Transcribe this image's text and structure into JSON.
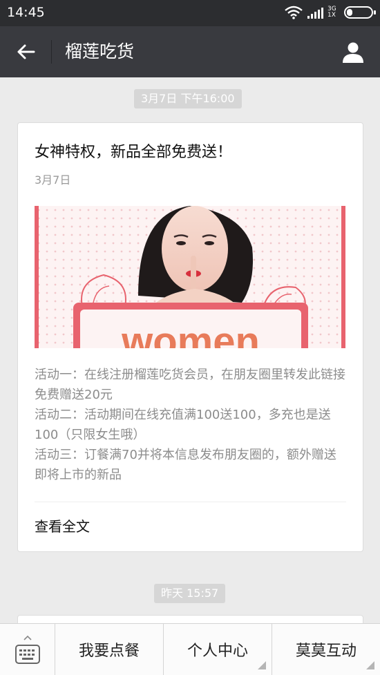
{
  "status_bar": {
    "time": "14:45",
    "network_top": "3G",
    "network_bottom": "1X"
  },
  "nav": {
    "title": "榴莲吃货",
    "back_icon": "arrow-left-icon",
    "profile_icon": "person-icon"
  },
  "timestamps": {
    "first": "3月7日 下午16:00",
    "second": "昨天 15:57"
  },
  "article": {
    "title": "女神特权，新品全部免费送！",
    "date": "3月7日",
    "image_text": "women",
    "description": [
      "活动一：在线注册榴莲吃货会员，在朋友圈里转发此链接免费赠送20元",
      "活动二：活动期间在线充值满100送100，多充也是送100（只限女生哦）",
      "活动三：订餐满70并将本信息发布朋友圈的，额外赠送即将上市的新品"
    ],
    "read_more": "查看全文"
  },
  "menu": {
    "keyboard_icon": "keyboard-icon",
    "items": [
      {
        "label": "我要点餐"
      },
      {
        "label": "个人中心"
      },
      {
        "label": "莫莫互动"
      }
    ]
  },
  "colors": {
    "status_bar": "#2c2d30",
    "nav_bar": "#393a3f",
    "background": "#ebebeb",
    "accent_pink": "#e8636e",
    "image_text": "#e87b5a"
  }
}
